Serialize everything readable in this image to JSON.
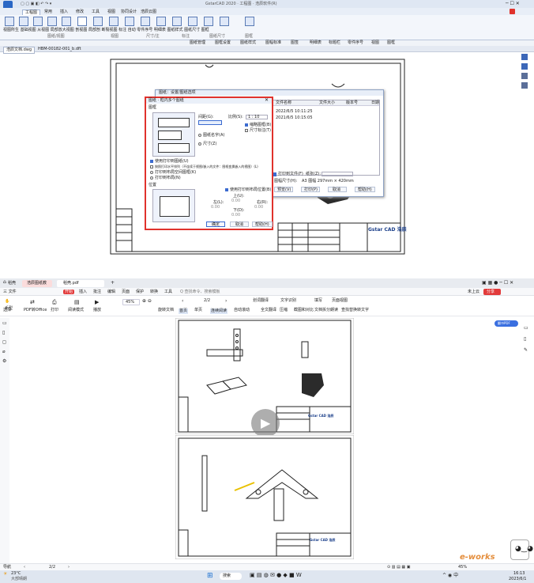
{
  "top_app": {
    "title_center": "GstarCAD 2020 · 工程图 · 浩辰软件(R)",
    "menu_tabs": [
      "工程图",
      "常用",
      "插入",
      "修改",
      "工具",
      "视图",
      "协同设计",
      "浩辰云图"
    ],
    "ribbon_groups": [
      "图纸/视图",
      "视图",
      "尺寸/注",
      "标注",
      "图纸尺寸",
      "图框"
    ],
    "doc_tabs": [
      "浩辰文档.dwg",
      "HBM-00182-001_b.dft"
    ],
    "toolbar2": [
      "图纸管理",
      "图框设置",
      "图纸样式",
      "图幅标准",
      "图签",
      "明细表",
      "标题栏",
      "零件序号",
      "视图",
      "图框"
    ],
    "dialog_back": {
      "title": "图纸：设置/图纸选项",
      "columns": [
        "文件名称",
        "文件大小",
        "版本号",
        "日期"
      ],
      "rows": [
        "2022/6/5 10:11:25",
        "2021/6/5 10:15:05"
      ],
      "labels": {
        "checkbox": "打印到文件(F)",
        "paper": "纸张(Z):",
        "size_label": "图幅尺寸(H):",
        "size_value": "A3 图幅 297mm × 420mm"
      },
      "buttons": [
        "预览(V)",
        "打印(P)",
        "取消",
        "帮助(H)"
      ]
    },
    "dialog_front": {
      "title": "图纸 · 框内多个图纸",
      "section_layout": "图框",
      "field_scale_label": "比例(S):",
      "field_scale_value": "1 : 10",
      "field_width_label": "间距(G):",
      "radios": [
        "图纸名字(A)",
        "尺寸(Z)"
      ],
      "checks": [
        "缩略图框(B)",
        "尺寸标注(T)"
      ],
      "options": [
        "使用打印到图纸(U)",
        "按照打印水平排列（不连续于视图/嵌入的文件：图框变换嵌入的视图）(L)",
        "打印到布局空间图框(K)",
        "打印到布局(N)"
      ],
      "section_pos": "位置",
      "check_pos": "使用打印到布局位置(B)",
      "pos_labels": {
        "up": "上(U):",
        "down": "下(D):",
        "left": "左(L):",
        "right": "右(R):",
        "value": "0.00"
      },
      "buttons": [
        "确定",
        "取消",
        "帮助(H)"
      ]
    },
    "drawing": {
      "brand": "Gstar CAD 浩辰"
    }
  },
  "wps": {
    "tabs": [
      "稻壳",
      "浩辰图纸教",
      "稻壳.pdf"
    ],
    "file_menu": "三 文件",
    "menus": [
      "开始",
      "插入",
      "批注",
      "编辑",
      "页面",
      "保护",
      "转换",
      "工具",
      "Q 查找命令、搜索模板"
    ],
    "right_top": [
      "未上云",
      "分享"
    ],
    "toolbar": [
      {
        "icon": "hand-icon",
        "label": "手型"
      },
      {
        "icon": "select-icon",
        "label": "选择"
      },
      {
        "icon": "pdf-to-office-icon",
        "label": "PDF转Office"
      },
      {
        "icon": "print-icon",
        "label": "打印"
      },
      {
        "icon": "read-mode-icon",
        "label": "阅读模式"
      },
      {
        "icon": "play-icon",
        "label": "播放"
      },
      {
        "icon": "zoom-icon",
        "label": "缩放"
      },
      {
        "icon": "rotate-icon",
        "label": "旋转文档"
      },
      {
        "icon": "translate-icon",
        "label": "划词翻译"
      },
      {
        "icon": "ocr-icon",
        "label": "文字识别"
      },
      {
        "icon": "fill-icon",
        "label": "填写"
      },
      {
        "icon": "page-view-icon",
        "label": "页面视图"
      }
    ],
    "zoom_value": "45%",
    "page_indicator": "2/2",
    "toolbar_row2": [
      "首页",
      "单页",
      "双页",
      "连续阅读",
      "自动滚动",
      "全文翻译",
      "压缩",
      "截图和对比",
      "文档拆分",
      "朗读",
      "查找替换",
      "转文字"
    ],
    "side_badge": "翻书PDF",
    "status": {
      "left": "导航",
      "page": "2/2",
      "zoom": "45%"
    },
    "drawing_brand": "Gstar CAD 浩辰",
    "weather": {
      "temp": "23°C",
      "desc": "大部晴朗"
    },
    "taskbar": {
      "search": "搜索",
      "clock": "16:13",
      "date": "2023/6/1"
    },
    "watermark": "e-works",
    "play_label": "播放"
  },
  "colors": {
    "accent_red": "#e0322c",
    "ribbon_bg": "#dfe7f3",
    "wps_tab_red": "#e23b3b",
    "dialog_border_highlight": "#e0322c",
    "taskbar_bg": "#dfe6f0"
  }
}
